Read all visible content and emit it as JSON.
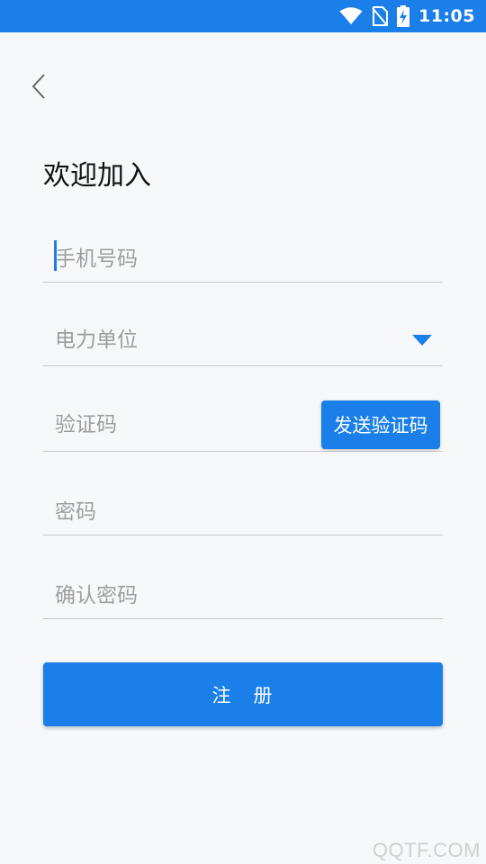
{
  "status_bar": {
    "time": "11:05",
    "icons": [
      "wifi-icon",
      "no-sim-icon",
      "battery-charging-icon"
    ],
    "background": "#1a7fe8"
  },
  "header": {
    "back_icon": "chevron-left-icon"
  },
  "page": {
    "title": "欢迎加入"
  },
  "form": {
    "phone": {
      "value": "",
      "placeholder": "手机号码"
    },
    "unit": {
      "label": "电力单位",
      "icon": "dropdown-triangle-icon"
    },
    "code": {
      "value": "",
      "placeholder": "验证码",
      "send_label": "发送验证码"
    },
    "password": {
      "value": "",
      "placeholder": "密码"
    },
    "confirm_password": {
      "value": "",
      "placeholder": "确认密码"
    }
  },
  "register_button": {
    "label": "注　册"
  },
  "watermark": "QQTF.COM",
  "colors": {
    "accent": "#1a7fe8",
    "background": "#f7f8fa",
    "placeholder": "#9e9e9e"
  }
}
